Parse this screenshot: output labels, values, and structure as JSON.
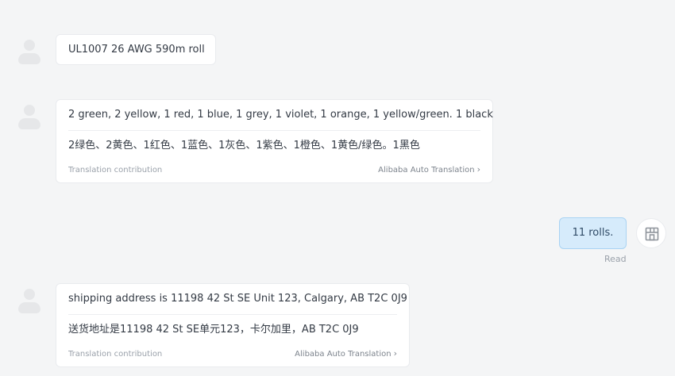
{
  "messages": [
    {
      "text": "UL1007 26 AWG 590m roll"
    },
    {
      "original": "2 green, 2 yellow, 1 red, 1 blue, 1 grey, 1 violet, 1 orange, 1 yellow/green. 1 black",
      "translation": "2绿色、2黄色、1红色、1蓝色、1灰色、1紫色、1橙色、1黄色/绿色。1黑色",
      "contribution_label": "Translation contribution",
      "auto_translation_label": "Alibaba Auto Translation"
    },
    {
      "text": "11 rolls.",
      "status": "Read"
    },
    {
      "original": "shipping address is 11198 42 St SE Unit 123, Calgary, AB T2C 0J9",
      "translation": "送货地址是11198 42 St SE单元123，卡尔加里，AB T2C 0J9",
      "contribution_label": "Translation contribution",
      "auto_translation_label": "Alibaba Auto Translation"
    }
  ],
  "icons": {
    "contact_avatar": "user-silhouette-icon",
    "self_avatar": "store-icon",
    "chevron": "chevron-right-icon"
  },
  "colors": {
    "background": "#f4f5f6",
    "self_bubble": "#d6ebfb",
    "self_bubble_border": "#a9d3f3",
    "text": "#333a44",
    "muted": "#9aa1aa"
  }
}
